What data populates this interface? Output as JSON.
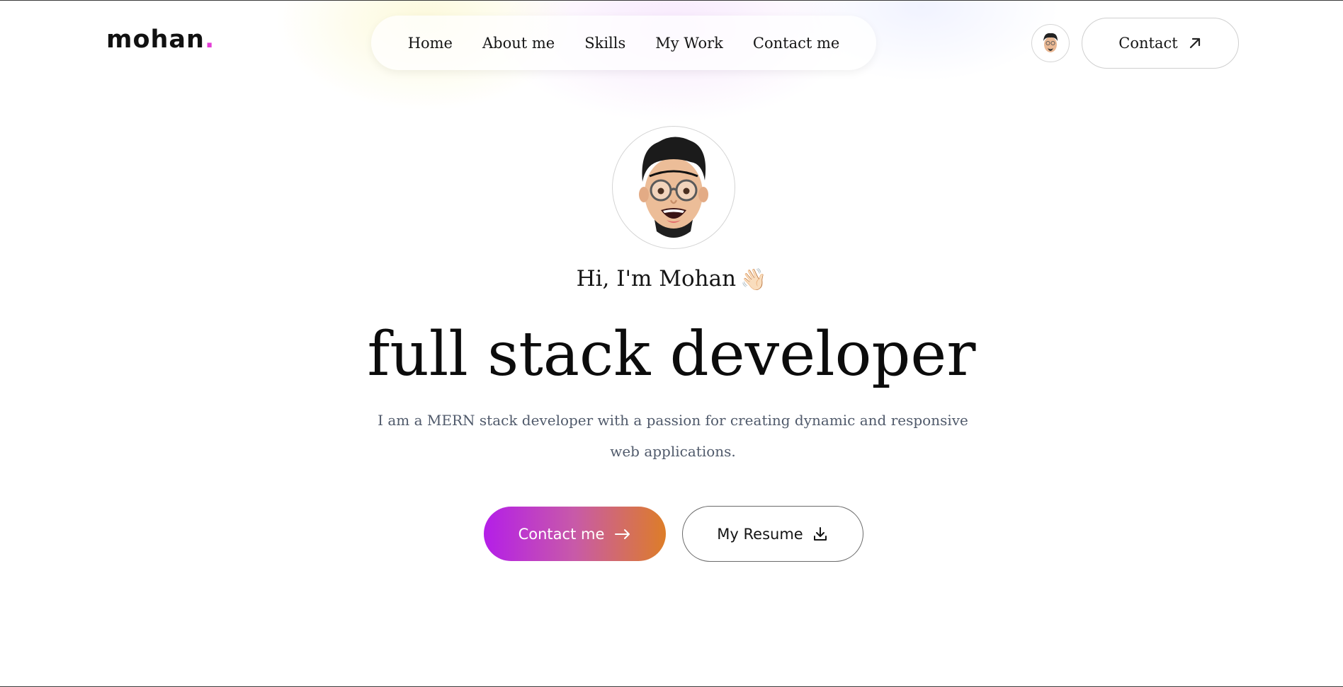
{
  "brand": {
    "name": "mohan",
    "dot": ".",
    "accent": "#e43fd6"
  },
  "nav": {
    "items": [
      "Home",
      "About me",
      "Skills",
      "My Work",
      "Contact me"
    ]
  },
  "header": {
    "contact_label": "Contact",
    "avatar_icon": "memoji-avatar-icon",
    "arrow_icon": "arrow-up-right-icon"
  },
  "hero": {
    "greeting": "Hi, I'm Mohan",
    "wave_emoji": "👋🏻",
    "title": "full stack developer",
    "description": "I am a MERN stack developer with a passion for creating dynamic and responsive web applications.",
    "primary_button": "Contact me",
    "secondary_button": "My Resume",
    "gradient": [
      "#b41ee8",
      "#dd7d28"
    ]
  }
}
